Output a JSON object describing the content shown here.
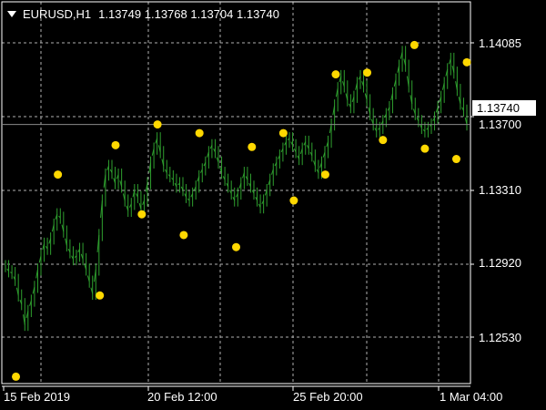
{
  "header": {
    "symbol_timeframe": "EURUSD,H1",
    "open": "1.13749",
    "high": "1.13768",
    "low": "1.13704",
    "close": "1.13740"
  },
  "price_tag": "1.13740",
  "colors": {
    "background": "#000000",
    "candles": "#2fa02f",
    "markers": "#ffd800",
    "grid": "#b0b0b0",
    "axis": "#ffffff"
  },
  "chart_data": {
    "type": "line",
    "instrument": "EURUSD",
    "timeframe": "H1",
    "x_ticks": [
      "15 Feb 2019",
      "20 Feb 12:00",
      "25 Feb 20:00",
      "1 Mar 04:00"
    ],
    "y_ticks": [
      "1.14085",
      "1.13700",
      "1.13310",
      "1.12920",
      "1.12530"
    ],
    "ylim": [
      1.1224,
      1.1445
    ],
    "current_price": 1.1374,
    "grid": true,
    "series": [
      {
        "values": [
          1.1292,
          1.1289,
          1.1288,
          1.1284,
          1.1275,
          1.127,
          1.1258,
          1.1266,
          1.1272,
          1.128,
          1.129,
          1.1298,
          1.1305,
          1.1302,
          1.1308,
          1.1316,
          1.1322,
          1.132,
          1.1312,
          1.1304,
          1.13,
          1.1296,
          1.1298,
          1.1302,
          1.1296,
          1.129,
          1.1283,
          1.1276,
          1.129,
          1.131,
          1.133,
          1.1345,
          1.135,
          1.1346,
          1.134,
          1.1345,
          1.1338,
          1.133,
          1.1324,
          1.1328,
          1.1336,
          1.1332,
          1.1325,
          1.133,
          1.134,
          1.1352,
          1.136,
          1.1366,
          1.1358,
          1.135,
          1.1346,
          1.1344,
          1.1342,
          1.1338,
          1.134,
          1.1336,
          1.1332,
          1.133,
          1.1334,
          1.1338,
          1.1344,
          1.1348,
          1.1352,
          1.1358,
          1.1362,
          1.1358,
          1.1352,
          1.1346,
          1.1342,
          1.1338,
          1.1334,
          1.133,
          1.1334,
          1.134,
          1.1346,
          1.1342,
          1.1338,
          1.1334,
          1.133,
          1.1326,
          1.133,
          1.1336,
          1.1342,
          1.1348,
          1.1352,
          1.1356,
          1.136,
          1.1364,
          1.1366,
          1.1362,
          1.1358,
          1.1354,
          1.136,
          1.1364,
          1.136,
          1.1356,
          1.135,
          1.1346,
          1.1352,
          1.1358,
          1.1364,
          1.1374,
          1.1385,
          1.1395,
          1.1402,
          1.1396,
          1.1388,
          1.1384,
          1.139,
          1.1398,
          1.1402,
          1.1396,
          1.1388,
          1.138,
          1.1374,
          1.137,
          1.1372,
          1.1376,
          1.138,
          1.1384,
          1.1392,
          1.14,
          1.1408,
          1.1416,
          1.1408,
          1.1396,
          1.1386,
          1.138,
          1.1376,
          1.1372,
          1.137,
          1.1372,
          1.1374,
          1.1378,
          1.1384,
          1.139,
          1.1398,
          1.1406,
          1.1412,
          1.1404,
          1.1394,
          1.1386,
          1.1382,
          1.1374
        ]
      }
    ],
    "markers": [
      {
        "i": 2,
        "price": 1.1228
      },
      {
        "i": 10,
        "price": 1.1345
      },
      {
        "i": 18,
        "price": 1.1275
      },
      {
        "i": 21,
        "price": 1.1362
      },
      {
        "i": 26,
        "price": 1.1322
      },
      {
        "i": 29,
        "price": 1.1374
      },
      {
        "i": 34,
        "price": 1.131
      },
      {
        "i": 37,
        "price": 1.1369
      },
      {
        "i": 44,
        "price": 1.1303
      },
      {
        "i": 47,
        "price": 1.1361
      },
      {
        "i": 53,
        "price": 1.1369
      },
      {
        "i": 55,
        "price": 1.133
      },
      {
        "i": 61,
        "price": 1.1345
      },
      {
        "i": 63,
        "price": 1.1403
      },
      {
        "i": 69,
        "price": 1.1404
      },
      {
        "i": 72,
        "price": 1.1365
      },
      {
        "i": 78,
        "price": 1.142
      },
      {
        "i": 80,
        "price": 1.136
      },
      {
        "i": 86,
        "price": 1.1354
      },
      {
        "i": 88,
        "price": 1.141
      }
    ]
  }
}
